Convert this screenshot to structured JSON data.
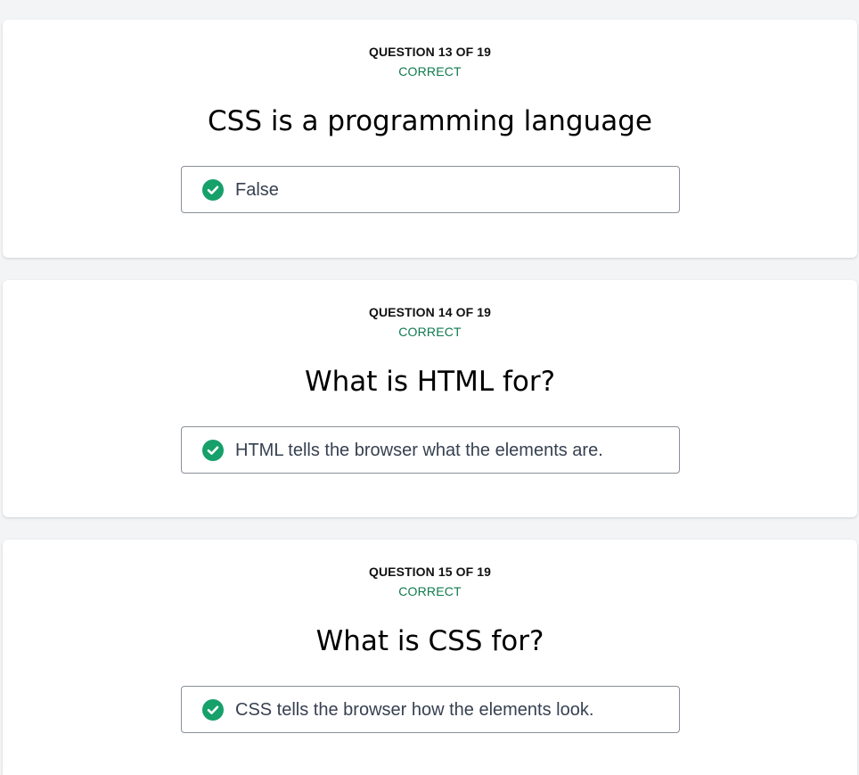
{
  "colors": {
    "correct": "#0f7a4f",
    "check_fill": "#16a06a",
    "page_bg": "#f3f4f6"
  },
  "questions": [
    {
      "number_label": "QUESTION 13 OF 19",
      "status": "CORRECT",
      "title": "CSS is a programming language",
      "answer": "False",
      "answer_icon": "check-circle-icon"
    },
    {
      "number_label": "QUESTION 14 OF 19",
      "status": "CORRECT",
      "title": "What is HTML for?",
      "answer": "HTML tells the browser what the elements are.",
      "answer_icon": "check-circle-icon"
    },
    {
      "number_label": "QUESTION 15 OF 19",
      "status": "CORRECT",
      "title": "What is CSS for?",
      "answer": "CSS tells the browser how the elements look.",
      "answer_icon": "check-circle-icon"
    }
  ]
}
